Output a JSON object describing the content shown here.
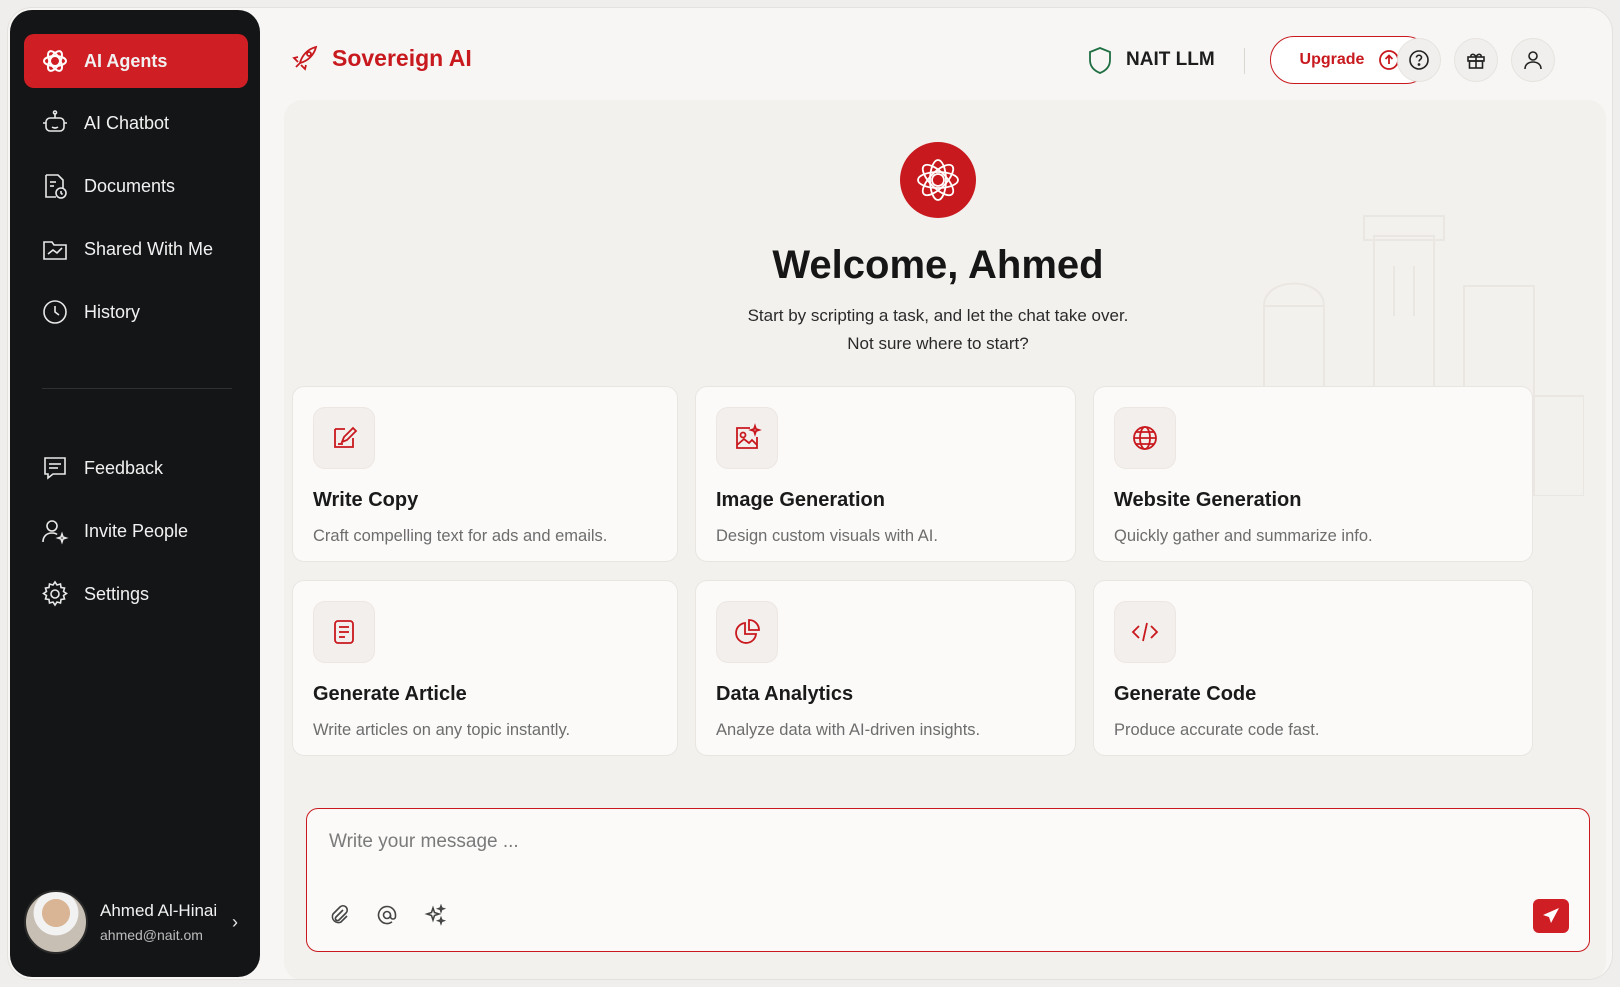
{
  "sidebar": {
    "items": [
      {
        "label": "AI Agents",
        "icon": "openai-knot-icon",
        "active": true
      },
      {
        "label": "AI Chatbot",
        "icon": "bot-icon"
      },
      {
        "label": "Documents",
        "icon": "document-clock-icon"
      },
      {
        "label": "Shared With Me",
        "icon": "shared-folder-icon"
      },
      {
        "label": "History",
        "icon": "clock-icon"
      }
    ],
    "bottom_items": [
      {
        "label": "Feedback",
        "icon": "feedback-icon"
      },
      {
        "label": "Invite People",
        "icon": "invite-user-icon"
      },
      {
        "label": "Settings",
        "icon": "gear-icon"
      }
    ],
    "user": {
      "name": "Ahmed Al-Hinai",
      "email": "ahmed@nait.om"
    }
  },
  "header": {
    "brand": "Sovereign AI",
    "model": "NAIT LLM",
    "upgrade_label": "Upgrade"
  },
  "welcome": {
    "title": "Welcome, Ahmed",
    "subtitle_line1": "Start by scripting a task, and let the chat take over.",
    "subtitle_line2": "Not sure where to start?"
  },
  "cards": [
    {
      "title": "Write Copy",
      "description": "Craft compelling text for ads and emails.",
      "icon": "edit-note-icon"
    },
    {
      "title": "Image Generation",
      "description": "Design custom visuals with AI.",
      "icon": "image-sparkle-icon"
    },
    {
      "title": "Website Generation",
      "description": "Quickly gather and summarize info.",
      "icon": "globe-icon"
    },
    {
      "title": "Generate Article",
      "description": "Write articles on any topic instantly.",
      "icon": "article-icon"
    },
    {
      "title": "Data Analytics",
      "description": "Analyze data with AI-driven insights.",
      "icon": "pie-chart-icon"
    },
    {
      "title": "Generate Code",
      "description": "Produce accurate code fast.",
      "icon": "code-icon"
    }
  ],
  "composer": {
    "placeholder": "Write your message ..."
  },
  "colors": {
    "accent": "#c8191e",
    "sidebar_bg": "#141517",
    "active_bg": "#d01f24"
  }
}
